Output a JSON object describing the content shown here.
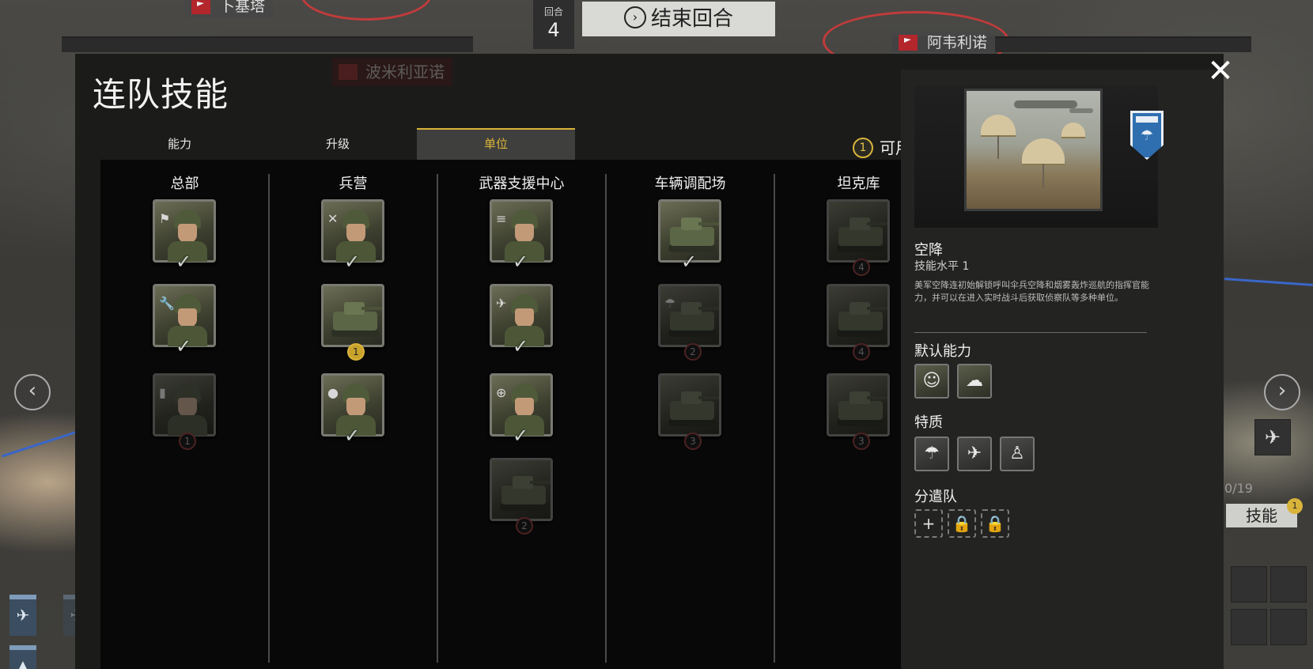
{
  "map": {
    "flag_left": "卜基塔",
    "flag_right": "阿韦利诺",
    "turn_label": "回合",
    "turn_number": "4",
    "end_turn": "结束回合",
    "end_turn_icon": "›",
    "ghost_count": "0/19",
    "skill_button": "技能",
    "skill_badge": "1",
    "nav_left": "‹",
    "nav_right": "›"
  },
  "panel": {
    "title": "连队技能",
    "ghost_town": "波米利亚诺",
    "close": "✕",
    "tabs": [
      {
        "label": "能力",
        "active": false
      },
      {
        "label": "升级",
        "active": false
      },
      {
        "label": "单位",
        "active": true
      }
    ],
    "available_count": "1",
    "available_label": "可用",
    "check": "✓",
    "columns": [
      {
        "title": "总部",
        "units": [
          {
            "kind": "soldier",
            "glyph": "⚑",
            "status": "owned"
          },
          {
            "kind": "soldier",
            "glyph": "🔧",
            "status": "owned"
          },
          {
            "kind": "soldier",
            "glyph": "▮",
            "status": "locked",
            "cost": "1"
          }
        ]
      },
      {
        "title": "兵营",
        "units": [
          {
            "kind": "soldier",
            "glyph": "✕",
            "status": "owned"
          },
          {
            "kind": "vehicle",
            "glyph": "",
            "status": "available",
            "cost": "1"
          },
          {
            "kind": "soldier",
            "glyph": "●",
            "status": "owned"
          }
        ]
      },
      {
        "title": "武器支援中心",
        "units": [
          {
            "kind": "soldier",
            "glyph": "≡",
            "status": "owned"
          },
          {
            "kind": "soldier",
            "glyph": "✈",
            "status": "owned"
          },
          {
            "kind": "soldier",
            "glyph": "⊕",
            "status": "owned"
          },
          {
            "kind": "vehicle",
            "glyph": "",
            "status": "locked",
            "cost": "2"
          }
        ]
      },
      {
        "title": "车辆调配场",
        "units": [
          {
            "kind": "vehicle",
            "glyph": "",
            "status": "owned"
          },
          {
            "kind": "vehicle",
            "glyph": "☂",
            "status": "locked",
            "cost": "2"
          },
          {
            "kind": "vehicle",
            "glyph": "",
            "status": "locked",
            "cost": "3"
          }
        ]
      },
      {
        "title": "坦克库",
        "units": [
          {
            "kind": "vehicle",
            "glyph": "",
            "status": "locked",
            "cost": "4"
          },
          {
            "kind": "vehicle",
            "glyph": "",
            "status": "locked",
            "cost": "4"
          },
          {
            "kind": "vehicle",
            "glyph": "",
            "status": "locked",
            "cost": "3"
          }
        ]
      }
    ]
  },
  "detail": {
    "name": "空降",
    "level": "技能水平 1",
    "description": "美军空降连初始解锁呼叫伞兵空降和烟雾轰炸巡航的指挥官能力，并可以在进入实时战斗后获取侦察队等多种单位。",
    "badge_icon": "parachute-icon",
    "default_abilities_heading": "默认能力",
    "traits_heading": "特质",
    "detachment_heading": "分遣队",
    "default_abilities": [
      {
        "icon": "soldier-portrait-icon",
        "glyph": "☺"
      },
      {
        "icon": "smoke-bomb-icon",
        "glyph": "☁"
      }
    ],
    "traits": [
      {
        "icon": "parachute-wings-icon",
        "glyph": "☂"
      },
      {
        "icon": "airplane-icon",
        "glyph": "✈"
      },
      {
        "icon": "squad-icon",
        "glyph": "♙"
      }
    ],
    "slots": [
      {
        "icon": "add-icon",
        "glyph": "+"
      },
      {
        "icon": "lock-icon",
        "glyph": "🔒"
      },
      {
        "icon": "lock-icon",
        "glyph": "🔒"
      }
    ]
  }
}
